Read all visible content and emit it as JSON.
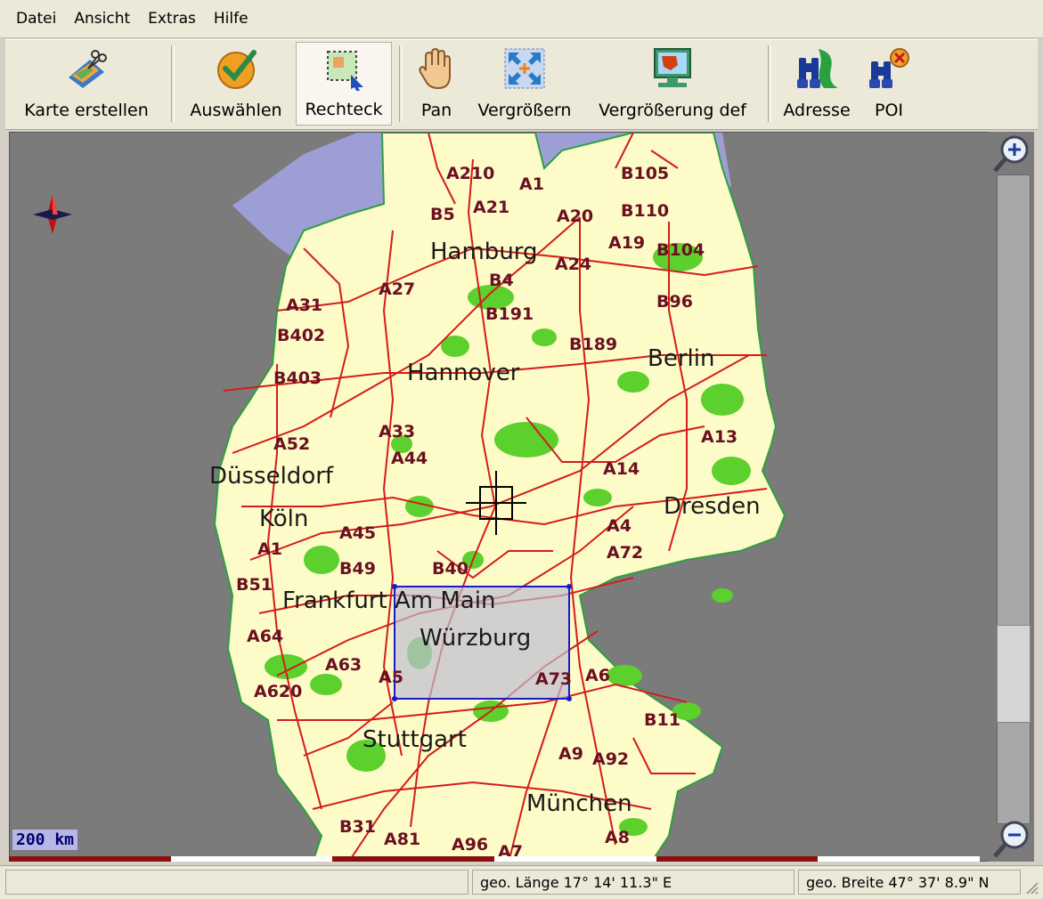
{
  "menu": [
    "Datei",
    "Ansicht",
    "Extras",
    "Hilfe"
  ],
  "toolbar": {
    "create_map": "Karte erstellen",
    "select": "Auswählen",
    "rectangle": "Rechteck",
    "pan": "Pan",
    "zoom": "Vergrößern",
    "zoom_def": "Vergrößerung def",
    "address": "Adresse",
    "poi": "POI"
  },
  "map": {
    "cities": [
      "Hamburg",
      "Hannover",
      "Berlin",
      "Düsseldorf",
      "Köln",
      "Dresden",
      "Frankfurt Am Main",
      "Würzburg",
      "Stuttgart",
      "München"
    ],
    "roads": [
      "A210",
      "A1",
      "B105",
      "B5",
      "A21",
      "A20",
      "B110",
      "A19",
      "B104",
      "A24",
      "A27",
      "B4",
      "A31",
      "B96",
      "B191",
      "B402",
      "B189",
      "B403",
      "A33",
      "A13",
      "A52",
      "A44",
      "A14",
      "A45",
      "A4",
      "A1",
      "A72",
      "B49",
      "B40",
      "B51",
      "A64",
      "A63",
      "A5",
      "A73",
      "A6",
      "A620",
      "B11",
      "A9",
      "A92",
      "B31",
      "A81",
      "A96",
      "A7",
      "A8"
    ],
    "scale": "200 km"
  },
  "status": {
    "longitude": "geo. Länge 17° 14' 11.3\" E",
    "latitude": "geo. Breite 47° 37'  8.9\" N"
  },
  "colors": {
    "land": "#fdfbc7",
    "water": "#9e9ed6",
    "forest": "#5cd02c",
    "road": "#d41c1c",
    "outside": "#7b7b7b",
    "selection": "#1a1acc"
  }
}
